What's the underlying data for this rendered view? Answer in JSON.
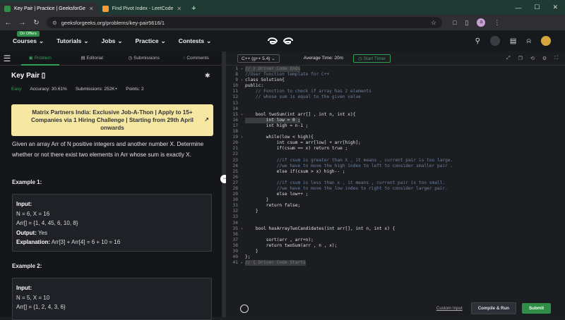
{
  "browser": {
    "tabs": [
      {
        "title": "Key Pair | Practice | GeeksforGe",
        "fav_color": "#2f8d46"
      },
      {
        "title": "Find Pivot Index - LeetCode",
        "fav_color": "#f29d38"
      }
    ],
    "new_tab": "+",
    "url": "geeksforgeeks.org/problems/key-pair5616/1"
  },
  "site": {
    "offers_badge": "On Offers",
    "menu": [
      "Courses",
      "Tutorials",
      "Jobs",
      "Practice",
      "Contests"
    ]
  },
  "left": {
    "tabs": [
      "Problem",
      "Editorial",
      "Submissions",
      "Comments"
    ],
    "title": "Key Pair",
    "difficulty": "Easy",
    "accuracy": "Accuracy: 30.61%",
    "submissions": "Submissions: 252K+",
    "points": "Points: 2",
    "banner": "Matrix Partners India: Exclusive Job-A-Thon | Apply to 15+ Companies via 1 Hiring Challenge | Starting from 29th April onwards",
    "description": "Given an array Arr of N positive integers and another number X. Determine whether or not there exist two elements in Arr whose sum is exactly X.",
    "example1": {
      "heading": "Example 1:",
      "input_label": "Input:",
      "line1": "N = 6, X = 16",
      "line2": "Arr[] = {1, 4, 45, 6, 10, 8}",
      "output_label": "Output:",
      "output": "Yes",
      "expl_label": "Explanation:",
      "expl": "Arr[3] + Arr[4] = 6 + 10 = 16"
    },
    "example2": {
      "heading": "Example 2:",
      "input_label": "Input:",
      "line1": "N = 5, X = 10",
      "line2": "Arr[] = {1, 2, 4, 3, 6}"
    }
  },
  "editor": {
    "language": "C++ (g++ 5.4)",
    "average_time": "Average Time: 20m",
    "timer": "Start Timer",
    "lines": [
      {
        "n": "1",
        "t": "// } Driver Code Ends",
        "c": "#777777",
        "fold": "▾",
        "hl": true
      },
      {
        "n": "8",
        "t": "//User function template for C++",
        "c": "#6b7f9e"
      },
      {
        "n": "9",
        "t": "class Solution{",
        "c": "#e0e0e0",
        "fold": "▾"
      },
      {
        "n": "10",
        "t": "public:",
        "c": "#e0e0e0"
      },
      {
        "n": "11",
        "t": "    // Function to check if array has 2 elements",
        "c": "#6b7f9e"
      },
      {
        "n": "12",
        "t": "    // whose sum is equal to the given value",
        "c": "#6b7f9e"
      },
      {
        "n": "13",
        "t": "",
        "c": "#e0e0e0"
      },
      {
        "n": "14",
        "t": "",
        "c": "#e0e0e0"
      },
      {
        "n": "15",
        "t": "    bool twoSum(int arr[] , int n, int x){",
        "c": "#e0e0e0",
        "fold": "▾"
      },
      {
        "n": "16",
        "t": "        int low = 0 ;",
        "c": "#e0e0e0",
        "hl": true
      },
      {
        "n": "17",
        "t": "        int high = n-1 ;",
        "c": "#e0e0e0"
      },
      {
        "n": "18",
        "t": "",
        "c": "#e0e0e0"
      },
      {
        "n": "19",
        "t": "        while(low < high){",
        "c": "#e0e0e0",
        "fold": "▾"
      },
      {
        "n": "20",
        "t": "            int csum = arr[low] + arr[high];",
        "c": "#e0e0e0"
      },
      {
        "n": "21",
        "t": "            if(csum == x) return true ;",
        "c": "#e0e0e0"
      },
      {
        "n": "22",
        "t": "",
        "c": "#e0e0e0"
      },
      {
        "n": "23",
        "t": "            //if csum is greater than X , it means , current pair is too large.",
        "c": "#6b7f9e"
      },
      {
        "n": "24",
        "t": "            //we have to move the high index to left to consider smaller pair .",
        "c": "#6b7f9e"
      },
      {
        "n": "25",
        "t": "            else if(csum > x) high-- ;",
        "c": "#e0e0e0"
      },
      {
        "n": "26",
        "t": "",
        "c": "#e0e0e0"
      },
      {
        "n": "27",
        "t": "            //if csum is less than x , it means , current pair is too small.",
        "c": "#6b7f9e"
      },
      {
        "n": "28",
        "t": "            //we have to move the low index to right to consider larger pair.",
        "c": "#6b7f9e"
      },
      {
        "n": "29",
        "t": "            else low++ ;",
        "c": "#e0e0e0"
      },
      {
        "n": "30",
        "t": "        }",
        "c": "#e0e0e0"
      },
      {
        "n": "31",
        "t": "        return false;",
        "c": "#e0e0e0"
      },
      {
        "n": "32",
        "t": "    }",
        "c": "#e0e0e0"
      },
      {
        "n": "33",
        "t": "",
        "c": "#e0e0e0"
      },
      {
        "n": "34",
        "t": "",
        "c": "#e0e0e0"
      },
      {
        "n": "35",
        "t": "    bool hasArrayTwoCandidates(int arr[], int n, int x) {",
        "c": "#e0e0e0",
        "fold": "▾"
      },
      {
        "n": "36",
        "t": "",
        "c": "#e0e0e0"
      },
      {
        "n": "37",
        "t": "        sort(arr , arr+n);",
        "c": "#e0e0e0"
      },
      {
        "n": "38",
        "t": "        return twoSum(arr , n , x);",
        "c": "#e0e0e0"
      },
      {
        "n": "39",
        "t": "    }",
        "c": "#e0e0e0"
      },
      {
        "n": "40",
        "t": "};",
        "c": "#e0e0e0"
      },
      {
        "n": "41",
        "t": "// { Driver Code Starts",
        "c": "#777777",
        "fold": "▸",
        "hl": true
      }
    ],
    "custom_input": "Custom Input",
    "compile": "Compile & Run",
    "submit": "Submit"
  }
}
